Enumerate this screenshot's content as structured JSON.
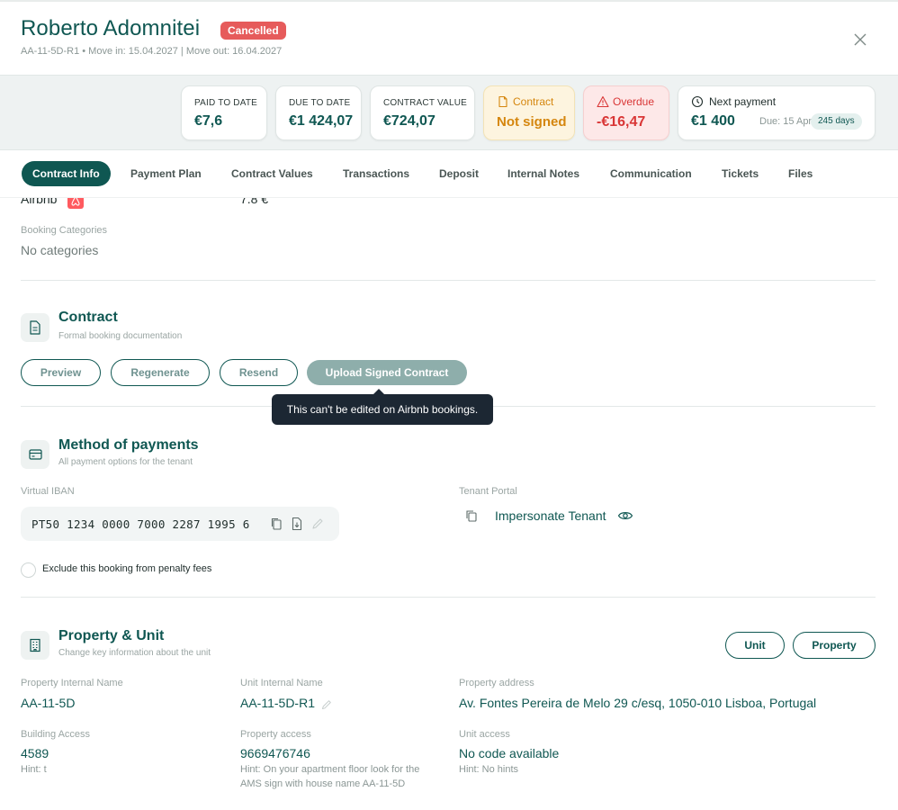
{
  "header": {
    "name": "Roberto Adomnitei",
    "status_badge": "Cancelled",
    "subtitle": "AA-11-5D-R1 • Move in: 15.04.2027 | Move out: 16.04.2027"
  },
  "stats": {
    "paid": {
      "label": "PAID TO DATE",
      "value": "€7,6"
    },
    "due": {
      "label": "DUE TO DATE",
      "value": "€1 424,07"
    },
    "contract_value": {
      "label": "CONTRACT VALUE",
      "value": "€724,07"
    },
    "contract": {
      "label": "Contract",
      "value": "Not signed"
    },
    "overdue": {
      "label": "Overdue",
      "value": "-€16,47"
    },
    "next_payment": {
      "label": "Next payment",
      "value": "€1 400",
      "due": "Due: 15 Apr",
      "days": "245 days"
    }
  },
  "tabs": [
    {
      "label": "Contract Info",
      "active": true
    },
    {
      "label": "Payment Plan"
    },
    {
      "label": "Contract Values"
    },
    {
      "label": "Transactions"
    },
    {
      "label": "Deposit"
    },
    {
      "label": "Internal Notes"
    },
    {
      "label": "Communication"
    },
    {
      "label": "Tickets"
    },
    {
      "label": "Files"
    }
  ],
  "booking": {
    "source": "Airbnb",
    "amount": "7.8 €",
    "categories_label": "Booking Categories",
    "categories_value": "No categories"
  },
  "contract_section": {
    "title": "Contract",
    "subtitle": "Formal booking documentation",
    "buttons": {
      "preview": "Preview",
      "regenerate": "Regenerate",
      "resend": "Resend",
      "upload": "Upload Signed Contract"
    },
    "tooltip": "This can't be edited on Airbnb bookings."
  },
  "payments_section": {
    "title": "Method of payments",
    "subtitle": "All payment options for the tenant",
    "iban_label": "Virtual IBAN",
    "iban_value": "PT50 1234 0000 7000 2287 1995 6",
    "portal_label": "Tenant Portal",
    "portal_link": "Impersonate Tenant",
    "penalty_checkbox": "Exclude this booking from penalty fees"
  },
  "property_section": {
    "title": "Property & Unit",
    "subtitle": "Change key information about the unit",
    "buttons": {
      "unit": "Unit",
      "property": "Property"
    },
    "property_internal_name_label": "Property Internal Name",
    "property_internal_name": "AA-11-5D",
    "unit_internal_name_label": "Unit Internal Name",
    "unit_internal_name": "AA-11-5D-R1",
    "property_address_label": "Property address",
    "property_address": "Av. Fontes Pereira de Melo 29 c/esq, 1050-010 Lisboa, Portugal",
    "building_access_label": "Building Access",
    "building_access": "4589",
    "building_access_hint": "Hint: t",
    "property_access_label": "Property access",
    "property_access": "9669476746",
    "property_access_hint": "Hint: On your apartment floor look for the AMS sign with house name AA-11-5D",
    "unit_access_label": "Unit access",
    "unit_access": "No code available",
    "unit_access_hint": "Hint: No hints"
  },
  "colors": {
    "primary": "#0f5752",
    "danger": "#d93636",
    "warning": "#d5860e",
    "badge_red": "#e65b5b"
  }
}
